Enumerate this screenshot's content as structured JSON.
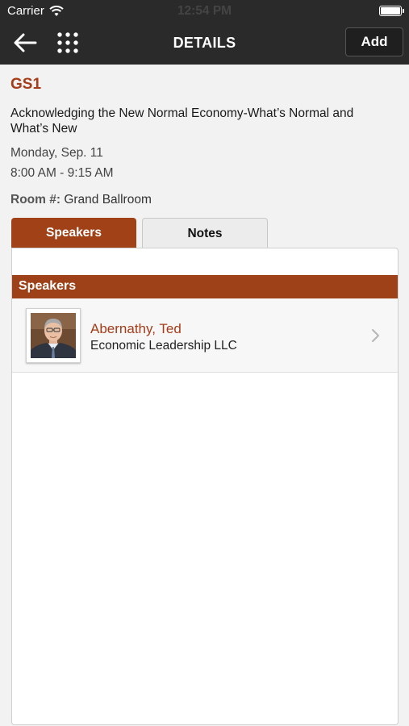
{
  "status_bar": {
    "carrier": "Carrier",
    "time": "12:54 PM"
  },
  "nav": {
    "title": "DETAILS",
    "add_label": "Add",
    "back_icon": "arrow-left-icon",
    "grid_icon": "grid-menu-icon"
  },
  "session": {
    "code": "GS1",
    "title": "Acknowledging the New Normal Economy-What’s Normal and What’s New",
    "date": "Monday, Sep. 11",
    "time": "8:00 AM - 9:15 AM",
    "room_label": "Room #:",
    "room": "Grand Ballroom"
  },
  "tabs": [
    {
      "label": "Speakers",
      "active": true
    },
    {
      "label": "Notes",
      "active": false
    }
  ],
  "speakers_section": {
    "header": "Speakers",
    "items": [
      {
        "name": "Abernathy, Ted",
        "organization": "Economic Leadership LLC"
      }
    ]
  },
  "colors": {
    "accent": "#a04118",
    "topbar": "#2a2a2a",
    "background": "#f2f2f2"
  }
}
